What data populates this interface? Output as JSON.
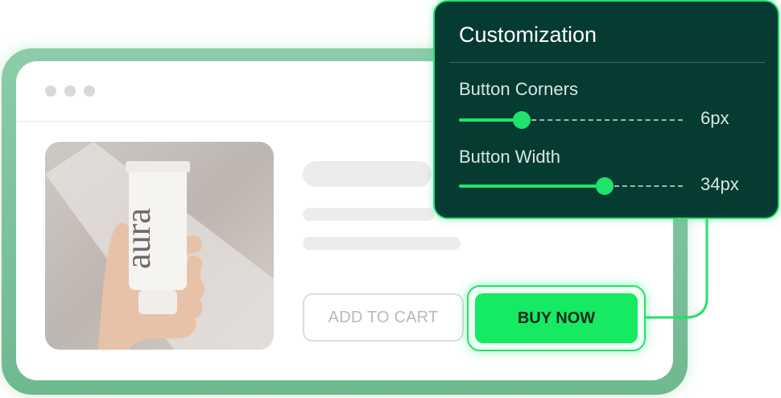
{
  "product": {
    "brand_text": "aura"
  },
  "actions": {
    "add_to_cart_label": "ADD TO CART",
    "buy_now_label": "BUY NOW"
  },
  "customization": {
    "title": "Customization",
    "sliders": [
      {
        "label": "Button Corners",
        "value_text": "6px",
        "level": 0.28
      },
      {
        "label": "Button Width",
        "value_text": "34px",
        "level": 0.65
      }
    ]
  },
  "colors": {
    "accent": "#1fe36a",
    "panel_bg": "#053b33",
    "frame": "#7cc39b"
  }
}
